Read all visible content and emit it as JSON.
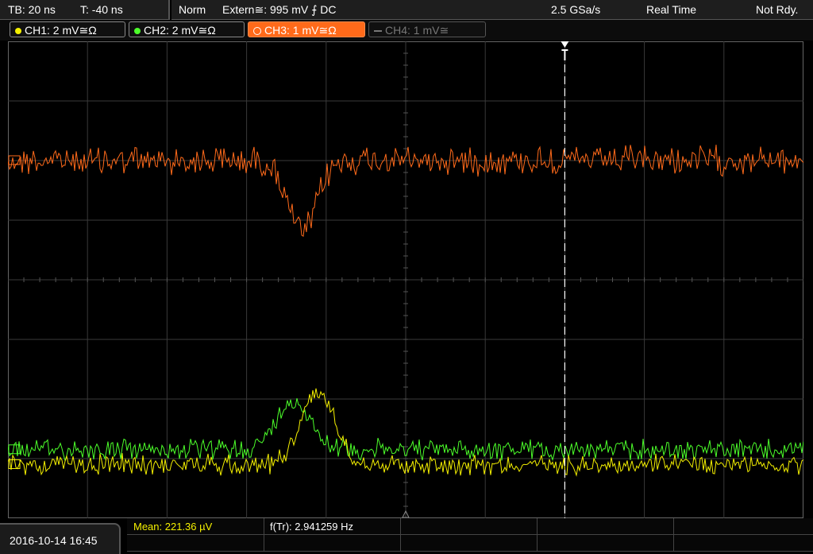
{
  "topbar": {
    "timebase": "TB: 20 ns",
    "trigger_time": "T: -40 ns",
    "trigger_mode": "Norm",
    "trigger_source": "Extern≅: 995 mV ⨍ DC",
    "sample_rate": "2.5 GSa/s",
    "acq_mode": "Real Time",
    "status": "Not Rdy."
  },
  "channels": [
    {
      "label": "CH1: 2 mV≅Ω",
      "color": "#f4f000"
    },
    {
      "label": "CH2: 2 mV≅Ω",
      "color": "#4cff2a"
    },
    {
      "label": "CH3: 1 mV≅Ω",
      "color": "#ff6a1a"
    },
    {
      "label": "CH4: 1 mV≅",
      "color": "#777777"
    }
  ],
  "measurements": {
    "mean": "Mean: 221.36 µV",
    "freq": "f(Tr): 2.941259 Hz"
  },
  "footer": {
    "datetime": "2016-10-14 16:45"
  },
  "colors": {
    "ch1": "#f4f000",
    "ch2": "#4cff2a",
    "ch3": "#ff6a1a",
    "grid": "#3a3a3a",
    "trigger_marker": "#ffffff"
  },
  "chart_data": {
    "type": "line",
    "title": "",
    "grid": true,
    "series": [
      {
        "name": "CH3",
        "color": "#ff6a1a",
        "baseline_div": 2.0,
        "pulse": {
          "direction": "down",
          "center_x_div": 3.7,
          "depth_div": 1.2
        }
      },
      {
        "name": "CH2",
        "color": "#4cff2a",
        "baseline_div": -2.85,
        "pulse": {
          "direction": "up",
          "center_x_div": 3.6,
          "height_div": 0.8
        }
      },
      {
        "name": "CH1",
        "color": "#f4f000",
        "baseline_div": -3.1,
        "pulse": {
          "direction": "up",
          "center_x_div": 3.9,
          "height_div": 1.2
        }
      }
    ],
    "x_divisions": 10,
    "y_divisions": 8,
    "trigger_x_div": 7.0
  }
}
